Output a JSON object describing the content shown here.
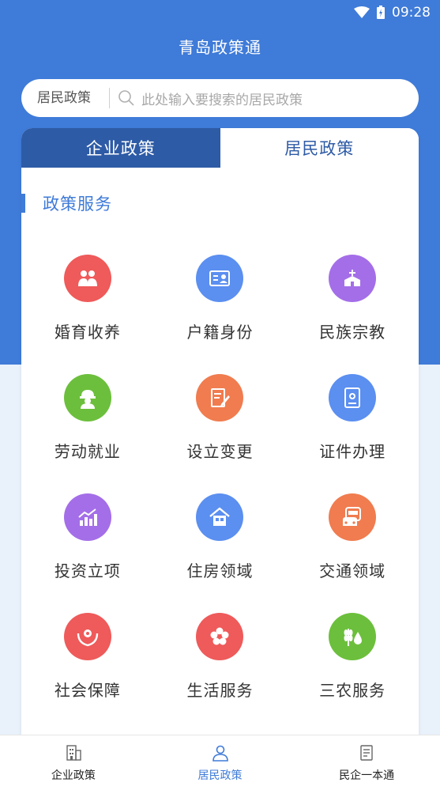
{
  "status": {
    "time": "09:28"
  },
  "app": {
    "title": "青岛政策通"
  },
  "search": {
    "scope": "居民政策",
    "placeholder": "此处输入要搜索的居民政策"
  },
  "tabs": [
    {
      "label": "企业政策",
      "active": false
    },
    {
      "label": "居民政策",
      "active": true
    }
  ],
  "section": {
    "title": "政策服务"
  },
  "services": [
    {
      "label": "婚育收养",
      "icon": "family-icon",
      "color": "#ef5a5a"
    },
    {
      "label": "户籍身份",
      "icon": "id-card-icon",
      "color": "#5b8ff0"
    },
    {
      "label": "民族宗教",
      "icon": "temple-icon",
      "color": "#a46ee8"
    },
    {
      "label": "劳动就业",
      "icon": "worker-helmet-icon",
      "color": "#6cbf3c"
    },
    {
      "label": "设立变更",
      "icon": "edit-document-icon",
      "color": "#f07c4f"
    },
    {
      "label": "证件办理",
      "icon": "certificate-icon",
      "color": "#5b8ff0"
    },
    {
      "label": "投资立项",
      "icon": "chart-growth-icon",
      "color": "#a46ee8"
    },
    {
      "label": "住房领域",
      "icon": "house-icon",
      "color": "#5b8ff0"
    },
    {
      "label": "交通领域",
      "icon": "bus-icon",
      "color": "#f07c4f"
    },
    {
      "label": "社会保障",
      "icon": "care-hands-icon",
      "color": "#ef5a5a"
    },
    {
      "label": "生活服务",
      "icon": "flower-icon",
      "color": "#ef5a5a"
    },
    {
      "label": "三农服务",
      "icon": "wheat-drop-icon",
      "color": "#6cbf3c"
    }
  ],
  "bottom_nav": [
    {
      "label": "企业政策",
      "icon": "building-icon",
      "active": false
    },
    {
      "label": "居民政策",
      "icon": "person-icon",
      "active": true
    },
    {
      "label": "民企一本通",
      "icon": "document-icon",
      "active": false
    }
  ],
  "colors": {
    "primary": "#3f7bd8",
    "tab_dark": "#2e5ba6"
  }
}
